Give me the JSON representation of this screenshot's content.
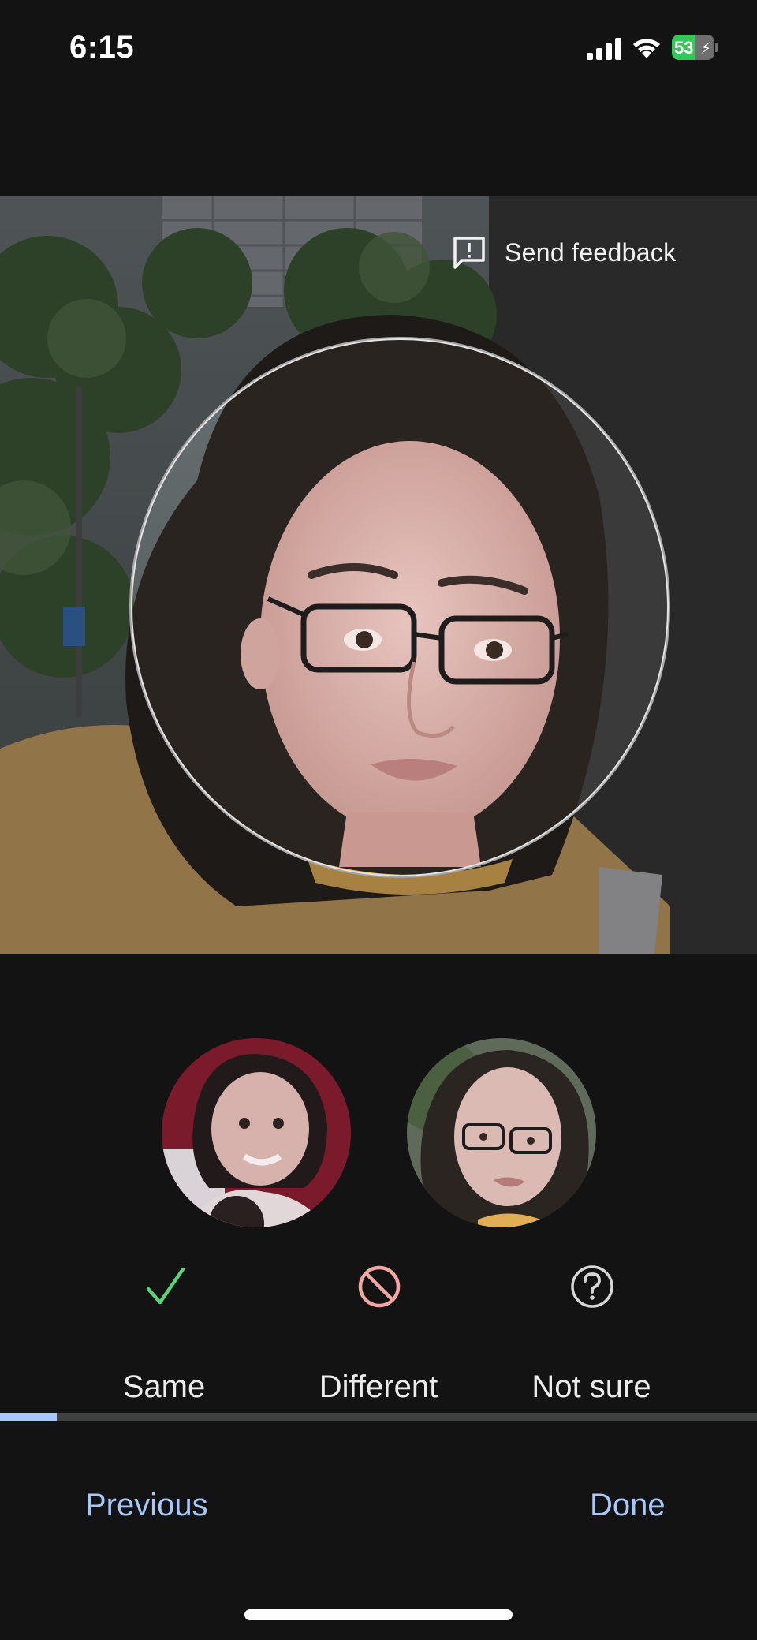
{
  "status_bar": {
    "time": "6:15",
    "battery_level": "53",
    "battery_percent": 53,
    "charging": true,
    "signal_icon": "cellular-signal-icon",
    "wifi_icon": "wifi-icon",
    "battery_icon": "battery-charging-icon"
  },
  "photo": {
    "feedback_label": "Send feedback",
    "feedback_icon": "feedback-icon"
  },
  "thumbnails": {
    "left_icon": "face-thumbnail-left",
    "right_icon": "face-thumbnail-right"
  },
  "choices": [
    {
      "label": "Same",
      "icon": "check-icon",
      "color": "#5bd17a"
    },
    {
      "label": "Different",
      "icon": "block-icon",
      "color": "#f2a7a2"
    },
    {
      "label": "Not sure",
      "icon": "help-circle-icon",
      "color": "#d7d7d7"
    }
  ],
  "progress": {
    "fraction": 0.075,
    "fill_color": "#a8c7fa",
    "track_color": "#3f4141"
  },
  "nav": {
    "previous_label": "Previous",
    "done_label": "Done",
    "accent": "#a8c7fa"
  },
  "colors": {
    "background": "#131313",
    "text": "#ececec"
  }
}
